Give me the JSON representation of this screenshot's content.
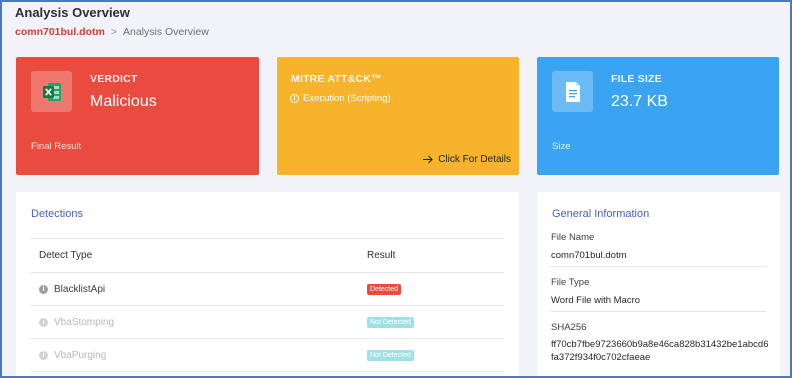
{
  "header": {
    "title": "Analysis Overview",
    "breadcrumb": {
      "file": "comn701bul.dotm",
      "separator": ">",
      "current": "Analysis Overview"
    }
  },
  "cards": {
    "verdict": {
      "label": "VERDICT",
      "value": "Malicious",
      "footer": "Final Result",
      "icon": "excel-file-icon",
      "color": "#e94b3f"
    },
    "mitre": {
      "label": "MITRE ATT&CK™",
      "technique": "Execution (Scripting)",
      "link": "Click For Details",
      "color": "#f7b32b"
    },
    "size": {
      "label": "FILE SIZE",
      "value": "23.7 KB",
      "footer": "Size",
      "icon": "document-icon",
      "color": "#3aa4f3"
    }
  },
  "detections": {
    "title": "Detections",
    "columns": [
      "Detect Type",
      "Result"
    ],
    "rows": [
      {
        "type": "BlacklistApi",
        "result": "Detected",
        "status": "detected"
      },
      {
        "type": "VbaStomping",
        "result": "Not Detected",
        "status": "not_detected"
      },
      {
        "type": "VbaPurging",
        "result": "Not Detected",
        "status": "not_detected"
      }
    ]
  },
  "general": {
    "title": "General Information",
    "file_name_label": "File Name",
    "file_name": "comn701bul.dotm",
    "file_type_label": "File Type",
    "file_type": "Word File with Macro",
    "sha256_label": "SHA256",
    "sha256": "ff70cb7fbe9723660b9a8e46ca828b31432be1abcd6fa372f934f0c702cfaeae"
  }
}
